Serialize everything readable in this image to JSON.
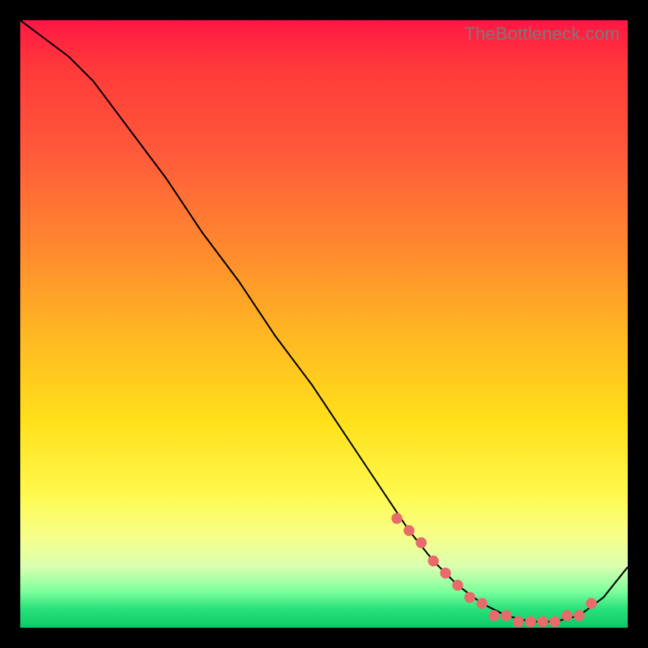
{
  "watermark": "TheBottleneck.com",
  "chart_data": {
    "type": "line",
    "title": "",
    "xlabel": "",
    "ylabel": "",
    "xlim": [
      0,
      100
    ],
    "ylim": [
      0,
      100
    ],
    "grid": false,
    "series": [
      {
        "name": "curve",
        "x": [
          0,
          4,
          8,
          12,
          18,
          24,
          30,
          36,
          42,
          48,
          54,
          60,
          64,
          68,
          72,
          76,
          80,
          84,
          88,
          92,
          96,
          100
        ],
        "y": [
          100,
          97,
          94,
          90,
          82,
          74,
          65,
          57,
          48,
          40,
          31,
          22,
          16,
          11,
          7,
          4,
          2,
          1,
          1,
          2,
          5,
          10
        ]
      }
    ],
    "highlight_points": {
      "name": "dots",
      "x": [
        62,
        64,
        66,
        68,
        70,
        72,
        74,
        76,
        78,
        80,
        82,
        84,
        86,
        88,
        90,
        92,
        94
      ],
      "y": [
        18,
        16,
        14,
        11,
        9,
        7,
        5,
        4,
        2,
        2,
        1,
        1,
        1,
        1,
        2,
        2,
        4
      ]
    },
    "colors": {
      "line": "#000000",
      "dot": "#e86a6a",
      "gradient_top": "#ff1744",
      "gradient_bottom": "#0fc966"
    }
  }
}
